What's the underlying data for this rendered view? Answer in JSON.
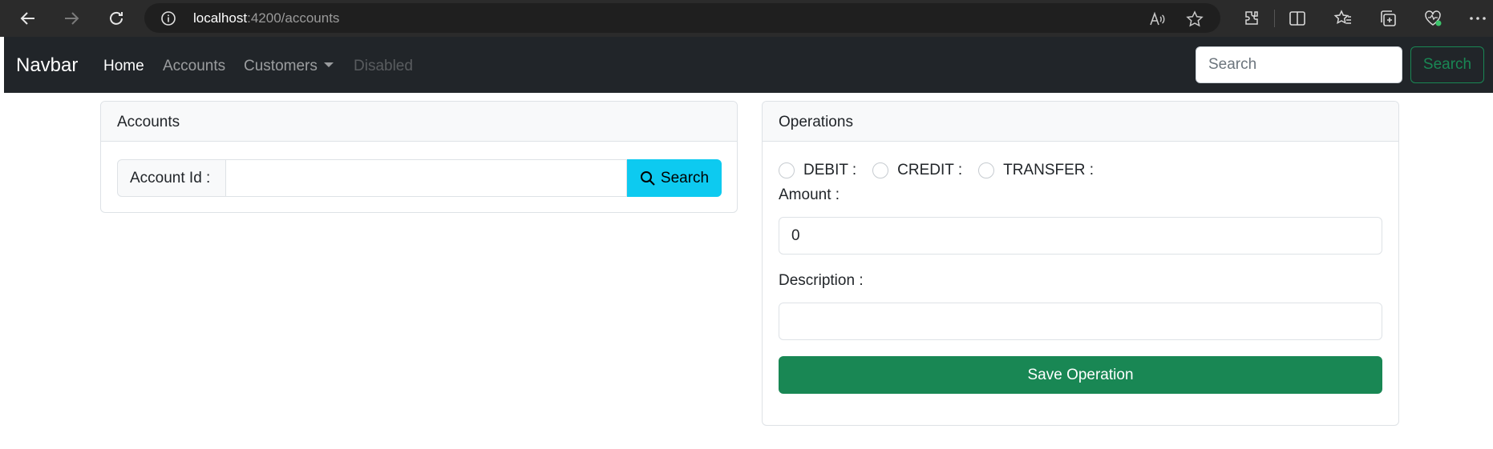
{
  "browser": {
    "url_host": "localhost",
    "url_path": ":4200/accounts"
  },
  "navbar": {
    "brand": "Navbar",
    "links": [
      {
        "label": "Home",
        "state": "active"
      },
      {
        "label": "Accounts",
        "state": "normal"
      },
      {
        "label": "Customers",
        "state": "dropdown"
      },
      {
        "label": "Disabled",
        "state": "disabled"
      }
    ],
    "search_placeholder": "Search",
    "search_button": "Search"
  },
  "accounts_card": {
    "title": "Accounts",
    "account_id_label": "Account Id :",
    "account_id_value": "",
    "search_button": "Search"
  },
  "operations_card": {
    "title": "Operations",
    "operation_types": [
      "DEBIT :",
      "CREDIT :",
      "TRANSFER :"
    ],
    "amount_label": "Amount :",
    "amount_value": "0",
    "description_label": "Description :",
    "description_value": "",
    "save_button": "Save Operation"
  },
  "colors": {
    "navbar_bg": "#212529",
    "primary_search_btn": "#0dcaf0",
    "success": "#198754"
  }
}
